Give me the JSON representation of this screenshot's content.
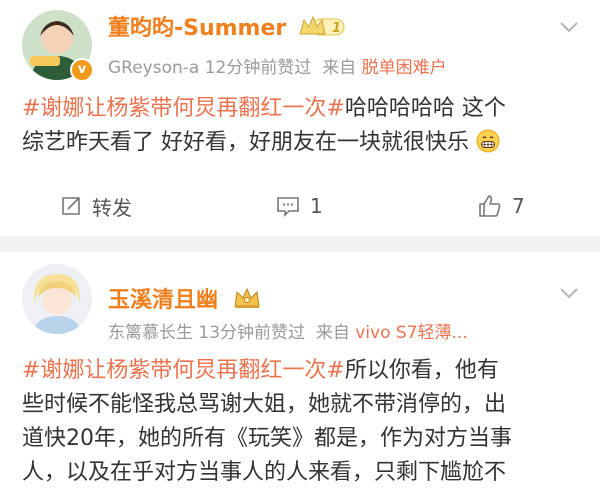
{
  "posts": [
    {
      "user_name": "董昀昀-Summer",
      "user_badge": "1",
      "meta_user": "GReyson-a",
      "meta_time": "12分钟前赞过",
      "meta_from": "来自",
      "meta_source": "脱单困难户",
      "hashtag": "#谢娜让杨紫带何炅再翻红一次#",
      "body_line1_rest": "哈哈哈哈哈 这个",
      "body_line2": "综艺昨天看了 好好看，好朋友在一块就很快乐",
      "emoji": "grin-emoji",
      "actions": {
        "repost_label": "转发",
        "comment_count": "1",
        "like_count": "7"
      }
    },
    {
      "user_name": "玉溪清且幽",
      "meta_user": "东篱慕长生",
      "meta_time": "13分钟前赞过",
      "meta_from": "来自",
      "meta_source": "vivo S7轻薄...",
      "hashtag": "#谢娜让杨紫带何炅再翻红一次#",
      "body_line1_rest": "所以你看，他有",
      "body_line2": "些时候不能怪我总骂谢大姐，她就不带消停的，出",
      "body_line3": "道快20年，她的所有《玩笑》都是，作为对方当事",
      "body_line4": "人，以及在乎对方当事人的人来看，只剩下尴尬不"
    }
  ],
  "colors": {
    "name": "#f0801e",
    "link": "#eb7350",
    "meta": "#9a9a9a",
    "divider": "#f2f2f2"
  }
}
